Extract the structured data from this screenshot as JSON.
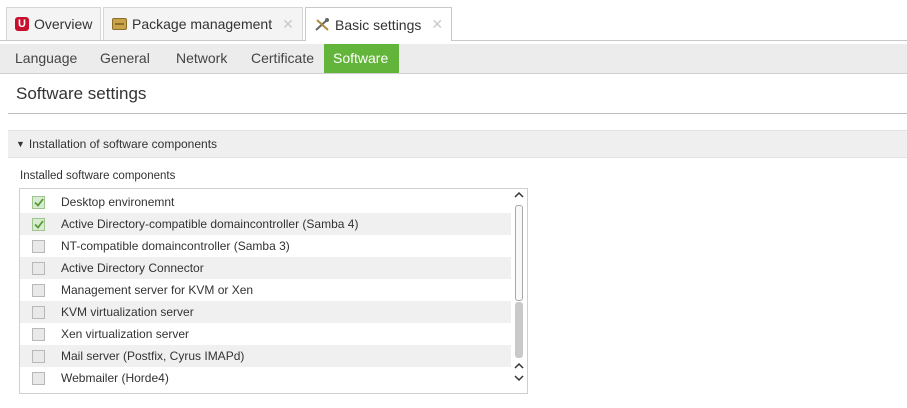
{
  "top_tabs": [
    {
      "label": "Overview",
      "icon": "univention-logo-icon",
      "closable": false,
      "active": false
    },
    {
      "label": "Package management",
      "icon": "package-icon",
      "closable": true,
      "active": false
    },
    {
      "label": "Basic settings",
      "icon": "tools-icon",
      "closable": true,
      "active": true
    }
  ],
  "close_glyph": "✕",
  "sub_tabs": [
    {
      "label": "Language",
      "active": false
    },
    {
      "label": "General",
      "active": false
    },
    {
      "label": "Network",
      "active": false
    },
    {
      "label": "Certificate",
      "active": false
    },
    {
      "label": "Software",
      "active": true
    }
  ],
  "page_title": "Software settings",
  "section": {
    "title": "Installation of software components",
    "expanded": true
  },
  "list": {
    "label": "Installed software components",
    "items": [
      {
        "label": "Desktop environemnt",
        "checked": true
      },
      {
        "label": "Active Directory-compatible domaincontroller (Samba 4)",
        "checked": true
      },
      {
        "label": "NT-compatible domaincontroller (Samba 3)",
        "checked": false
      },
      {
        "label": "Active Directory Connector",
        "checked": false
      },
      {
        "label": "Management server for KVM or Xen",
        "checked": false
      },
      {
        "label": "KVM virtualization server",
        "checked": false
      },
      {
        "label": "Xen virtualization server",
        "checked": false
      },
      {
        "label": "Mail server (Postfix, Cyrus IMAPd)",
        "checked": false
      },
      {
        "label": "Webmailer (Horde4)",
        "checked": false
      }
    ]
  },
  "colors": {
    "accent_green": "#63b43a",
    "brand_red": "#c8102e"
  }
}
